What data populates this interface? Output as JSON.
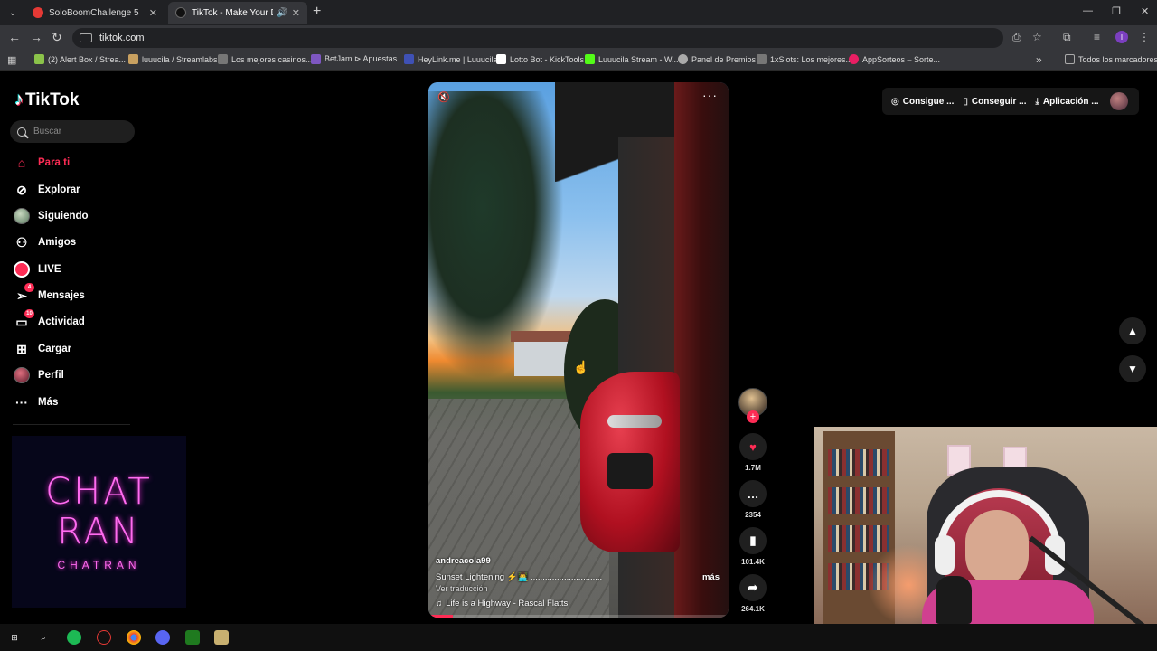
{
  "browser": {
    "tabs": [
      {
        "title": "SoloBoomChallenge 5",
        "active": false,
        "favicon_color": "#e53935"
      },
      {
        "title": "TikTok - Make Your Day",
        "active": true,
        "favicon_color": "#111111"
      }
    ],
    "url": "tiktok.com",
    "bookmarks": [
      {
        "label": "(2) Alert Box / Strea...",
        "color": "#8bc34a"
      },
      {
        "label": "luuucila / Streamlabs",
        "color": "#c8a060"
      },
      {
        "label": "Los mejores casinos...",
        "color": "#777777"
      },
      {
        "label": "BetJam ⊳ Apuestas...",
        "color": "#7e57c2"
      },
      {
        "label": "HeyLink.me | Luuucila",
        "color": "#3f51b5"
      },
      {
        "label": "Lotto Bot - KickTools",
        "color": "#ffffff"
      },
      {
        "label": "Luuucila Stream - W...",
        "color": "#53fc18"
      },
      {
        "label": "Panel de Premios",
        "color": "#aaaaaa"
      },
      {
        "label": "1xSlots: Los mejores...",
        "color": "#777777"
      },
      {
        "label": "AppSorteos – Sorte...",
        "color": "#e91e63"
      }
    ],
    "all_bookmarks_label": "Todos los marcadores"
  },
  "tiktok": {
    "logo": "TikTok",
    "search_placeholder": "Buscar",
    "nav": [
      {
        "label": "Para ti",
        "icon": "home-icon",
        "active": true
      },
      {
        "label": "Explorar",
        "icon": "compass-icon"
      },
      {
        "label": "Siguiendo",
        "icon": "following-avatar-icon"
      },
      {
        "label": "Amigos",
        "icon": "friends-icon"
      },
      {
        "label": "LIVE",
        "icon": "live-icon"
      },
      {
        "label": "Mensajes",
        "icon": "messages-icon",
        "badge": "4"
      },
      {
        "label": "Actividad",
        "icon": "activity-icon",
        "badge": "10"
      },
      {
        "label": "Cargar",
        "icon": "upload-icon"
      },
      {
        "label": "Perfil",
        "icon": "profile-icon"
      },
      {
        "label": "Más",
        "icon": "more-icon"
      }
    ],
    "overlay_brand": {
      "big_line1": "CHAT",
      "big_line2": "RAN",
      "small": "CHATRAN"
    },
    "video": {
      "author": "andreacola99",
      "description": "Sunset Lightening ⚡️👨‍💻 ..............................",
      "more_label": "más",
      "translate_label": "Ver traducción",
      "music": "Life is a Highway - Rascal Flatts",
      "progress": 0.08
    },
    "actions": {
      "likes": "1.7M",
      "comments": "2354",
      "saves": "101.4K",
      "shares": "264.1K"
    },
    "top_right": {
      "coins_label": "Consigue ...",
      "get_label": "Conseguir ...",
      "app_label": "Aplicación ..."
    }
  }
}
